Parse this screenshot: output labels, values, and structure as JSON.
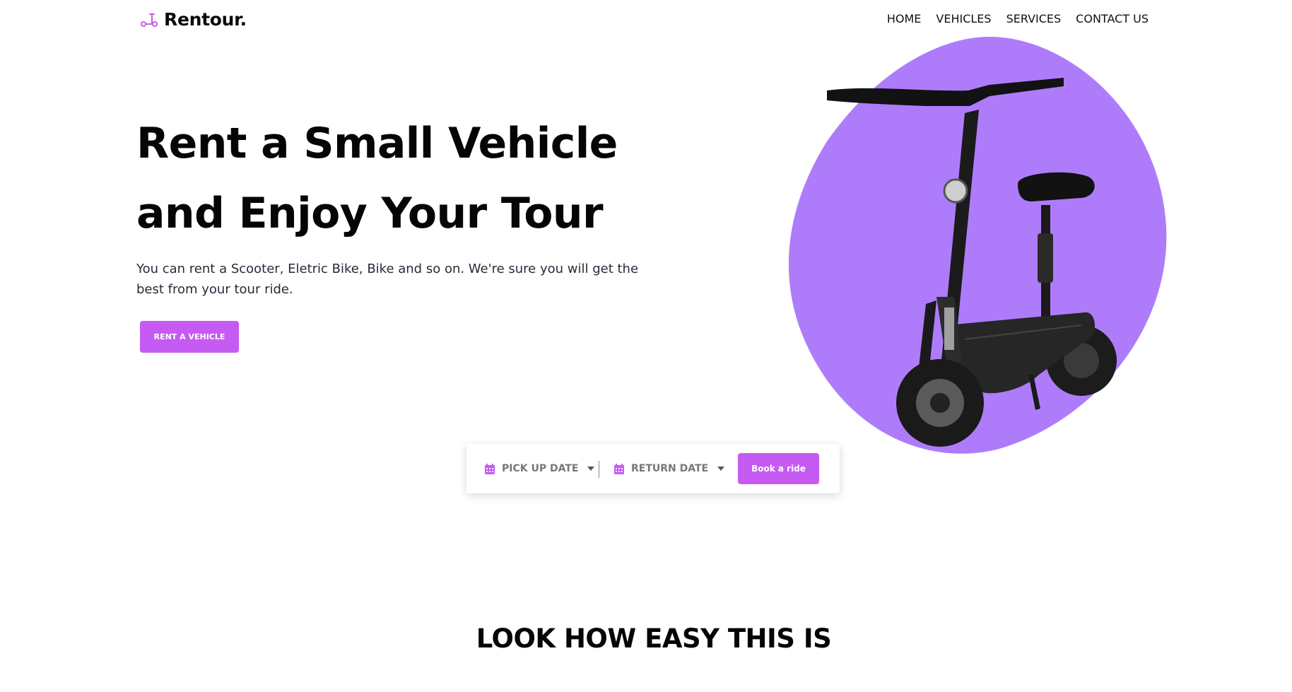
{
  "brand": {
    "name": "Rentour.",
    "accent": "#c55bf2",
    "blob": "#ae7cfb",
    "logo_icon": "scooter-icon"
  },
  "nav": {
    "items": [
      {
        "label": "HOME"
      },
      {
        "label": "VEHICLES"
      },
      {
        "label": "SERVICES"
      },
      {
        "label": "CONTACT US"
      }
    ]
  },
  "hero": {
    "title_line1": "Rent a Small Vehicle",
    "title_line2": "and Enjoy Your Tour",
    "description": "You can rent a Scooter, Eletric Bike, Bike and so on. We're sure you will get the best from your tour ride.",
    "cta_label": "RENT A VEHICLE",
    "image_icon": "electric-scooter-image"
  },
  "booking": {
    "pickup_label": "PICK UP DATE",
    "return_label": "RETURN DATE",
    "book_label": "Book a ride",
    "calendar_icon": "calendar-icon",
    "caret_icon": "caret-down-icon"
  },
  "section": {
    "title": "LOOK HOW EASY THIS IS"
  }
}
